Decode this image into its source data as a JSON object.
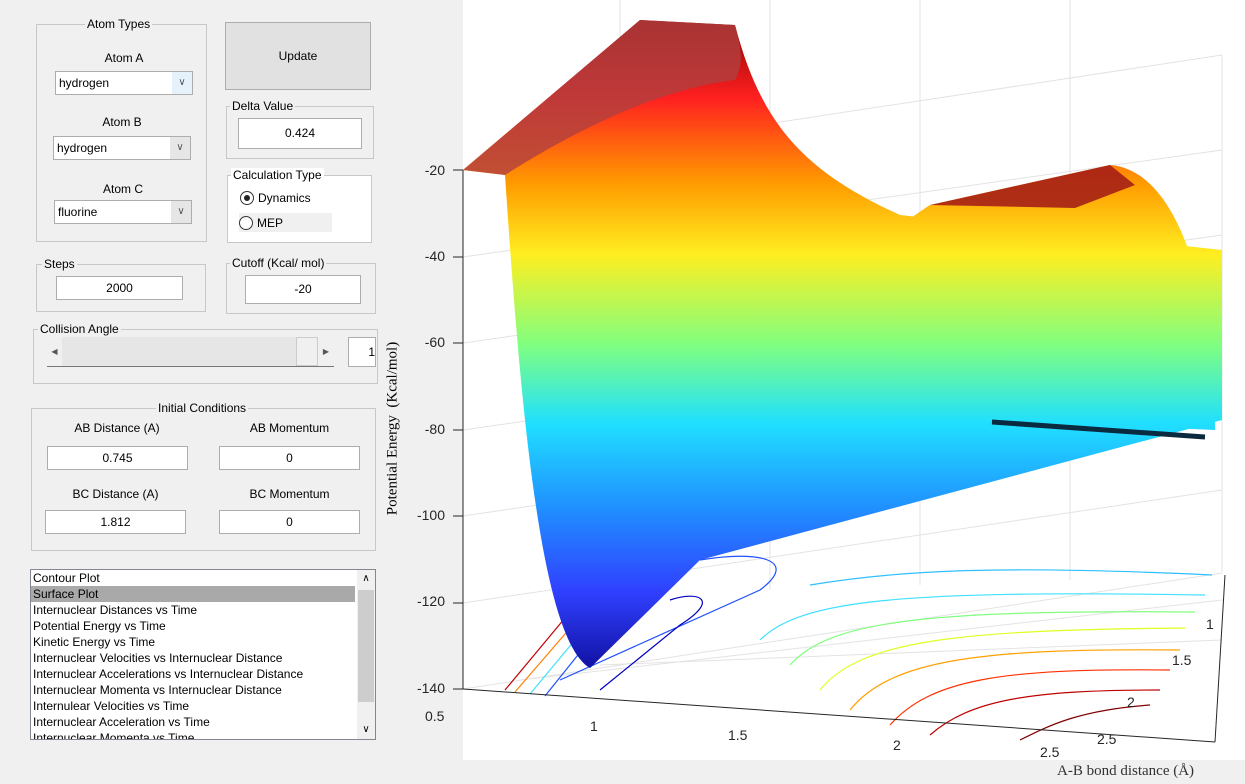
{
  "atom_types": {
    "title": "Atom Types",
    "atom_a": {
      "label": "Atom A",
      "value": "hydrogen"
    },
    "atom_b": {
      "label": "Atom B",
      "value": "hydrogen"
    },
    "atom_c": {
      "label": "Atom C",
      "value": "fluorine"
    }
  },
  "update_label": "Update",
  "delta": {
    "title": "Delta Value",
    "value": "0.424"
  },
  "calc_type": {
    "title": "Calculation Type",
    "options": [
      "Dynamics",
      "MEP"
    ],
    "selected": "Dynamics"
  },
  "steps": {
    "title": "Steps",
    "value": "2000"
  },
  "cutoff": {
    "title": "Cutoff (Kcal/ mol)",
    "value": "-20"
  },
  "collision": {
    "title": "Collision Angle",
    "value": "1"
  },
  "initial": {
    "title": "Initial Conditions",
    "ab_dist": {
      "label": "AB Distance (A)",
      "value": "0.745"
    },
    "ab_mom": {
      "label": "AB Momentum",
      "value": "0"
    },
    "bc_dist": {
      "label": "BC Distance (A)",
      "value": "1.812"
    },
    "bc_mom": {
      "label": "BC Momentum",
      "value": "0"
    }
  },
  "plot_list": {
    "items": [
      "Contour Plot",
      "Surface Plot",
      "Internuclear Distances vs Time",
      "Potential Energy vs Time",
      "Kinetic Energy vs Time",
      "Internuclear Velocities vs Internuclear Distance",
      "Internuclear Accelerations vs Internuclear Distance",
      "Internuclear Momenta vs Internuclear Distance",
      "Internulear Velocities vs Time",
      "Internuclear Acceleration vs Time",
      "Internuclear Momenta vs Time"
    ],
    "selected": "Surface Plot"
  },
  "chart_data": {
    "type": "surface",
    "zlabel": "Potential Energy  (Kcal/mol)",
    "xlabel": "A-B bond distance (Å)",
    "zticks": [
      "-20",
      "-40",
      "-60",
      "-80",
      "-100",
      "-120",
      "-140"
    ],
    "xticks": [
      "0.5",
      "1",
      "1.5",
      "2",
      "2.5"
    ],
    "yticks": [
      "1",
      "1.5",
      "2",
      "2.5"
    ],
    "zlim": [
      -140,
      -20
    ],
    "colormap": "jet",
    "contours_on_floor": true,
    "grid": true
  }
}
